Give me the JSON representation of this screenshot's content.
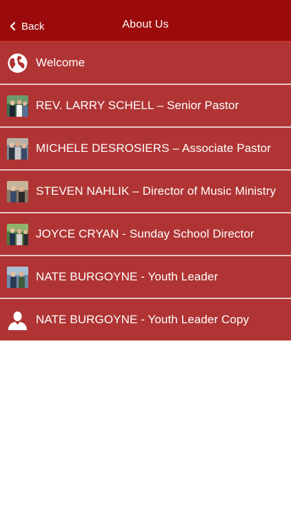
{
  "header": {
    "back_label": "Back",
    "title": "About Us"
  },
  "colors": {
    "navbar": "#9b0b0b",
    "list_background": "#b03434",
    "separator": "#e8c9c9",
    "text": "#ffffff"
  },
  "items": [
    {
      "label": "Welcome",
      "icon": "globe-icon"
    },
    {
      "label": "REV. LARRY SCHELL – Senior Pastor",
      "icon": "photo-thumbnail"
    },
    {
      "label": "MICHELE DESROSIERS – Associate Pastor",
      "icon": "photo-thumbnail"
    },
    {
      "label": "STEVEN NAHLIK – Director of Music Ministry",
      "icon": "photo-thumbnail"
    },
    {
      "label": "JOYCE CRYAN - Sunday School Director",
      "icon": "photo-thumbnail"
    },
    {
      "label": "NATE BURGOYNE - Youth Leader",
      "icon": "photo-thumbnail"
    },
    {
      "label": "NATE BURGOYNE - Youth Leader Copy",
      "icon": "person-icon"
    }
  ]
}
